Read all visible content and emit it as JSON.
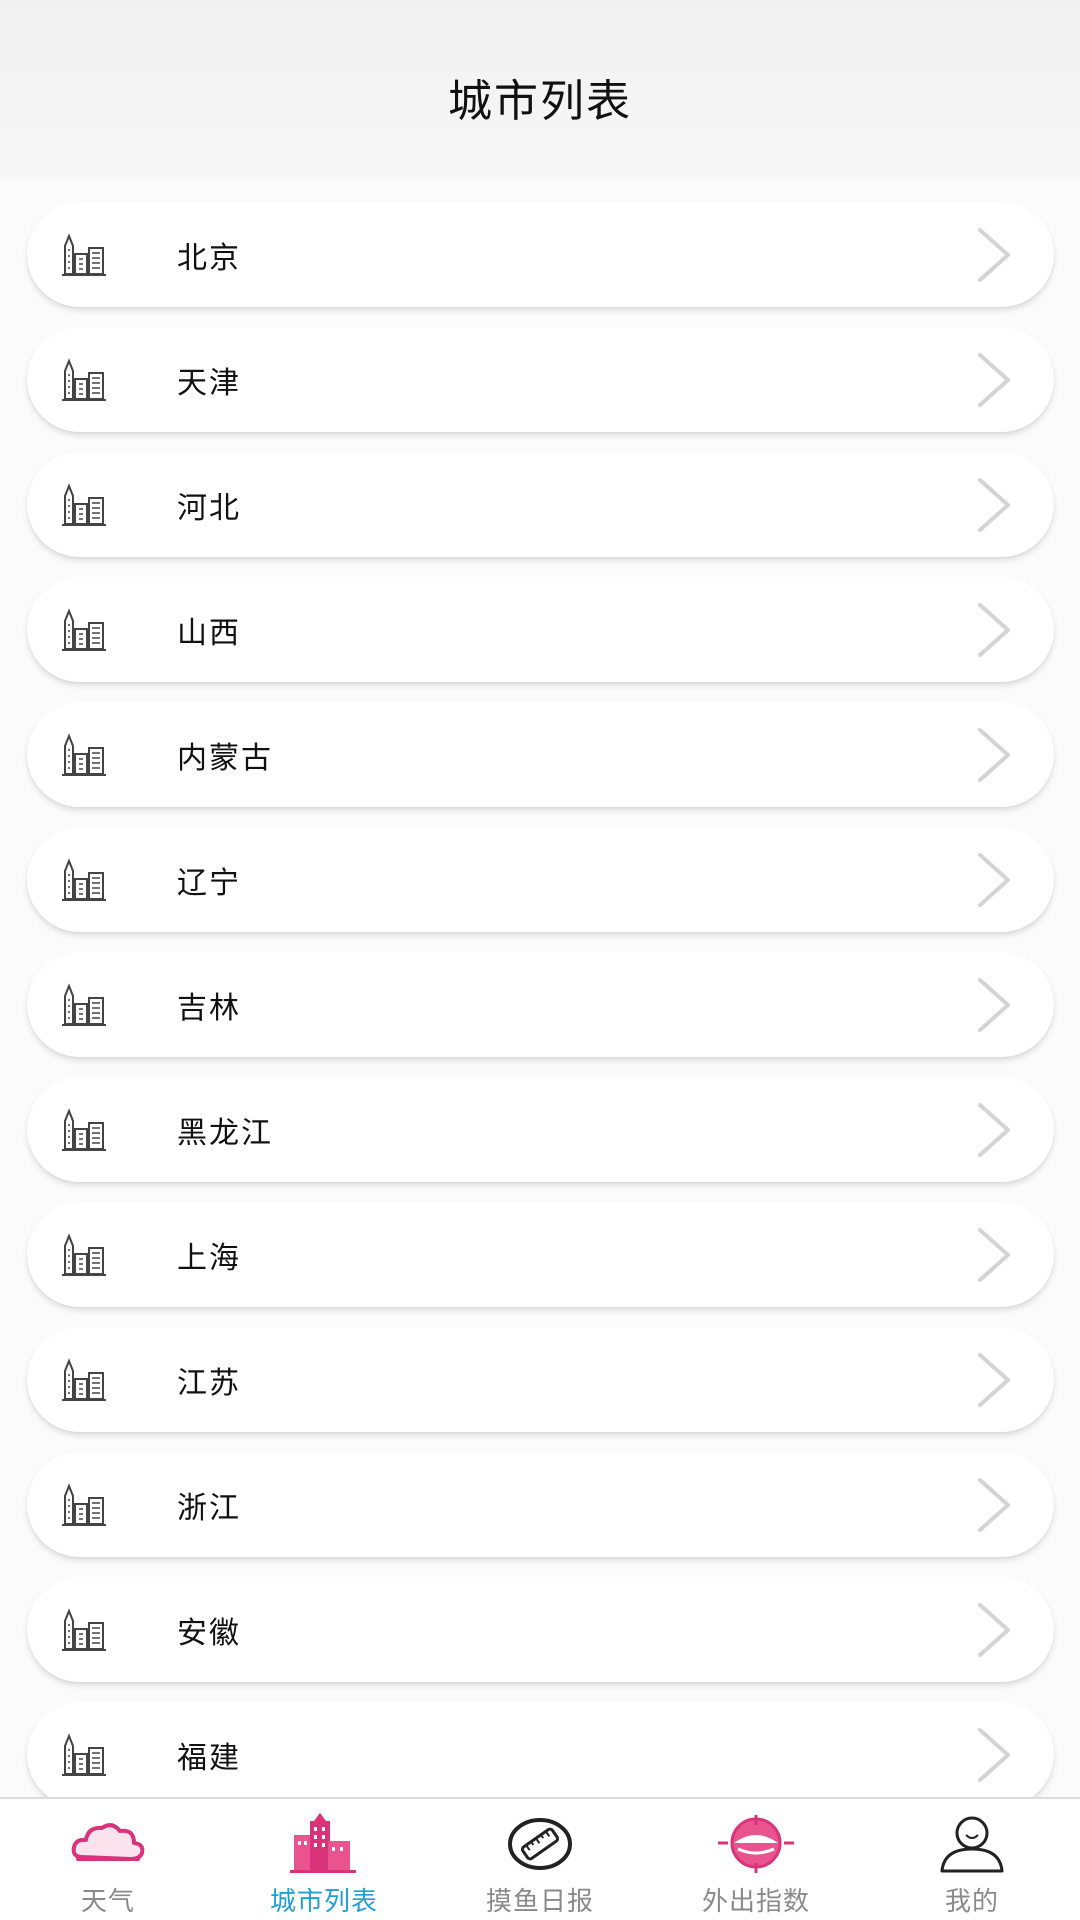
{
  "header": {
    "title": "城市列表"
  },
  "list": {
    "items": [
      {
        "label": "北京"
      },
      {
        "label": "天津"
      },
      {
        "label": "河北"
      },
      {
        "label": "山西"
      },
      {
        "label": "内蒙古"
      },
      {
        "label": "辽宁"
      },
      {
        "label": "吉林"
      },
      {
        "label": "黑龙江"
      },
      {
        "label": "上海"
      },
      {
        "label": "江苏"
      },
      {
        "label": "浙江"
      },
      {
        "label": "安徽"
      },
      {
        "label": "福建"
      }
    ]
  },
  "tabbar": {
    "tabs": [
      {
        "label": "天气",
        "icon": "cloud-icon"
      },
      {
        "label": "城市列表",
        "icon": "buildings-icon",
        "active": true
      },
      {
        "label": "摸鱼日报",
        "icon": "ruler-icon"
      },
      {
        "label": "外出指数",
        "icon": "target-icon"
      },
      {
        "label": "我的",
        "icon": "user-icon"
      }
    ]
  },
  "colors": {
    "accent_active": "#1f9fd4",
    "brand_pink": "#d9337a",
    "inactive_text": "#8a8a8a"
  }
}
